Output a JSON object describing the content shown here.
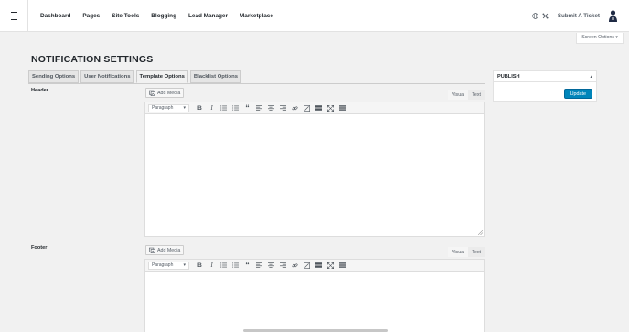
{
  "nav": {
    "items": [
      "Dashboard",
      "Pages",
      "Site Tools",
      "Blogging",
      "Lead Manager",
      "Marketplace"
    ],
    "submit_ticket": "Submit A Ticket"
  },
  "screen_options": "Screen Options ▾",
  "page_title": "NOTIFICATION SETTINGS",
  "tabs": [
    {
      "label": "Sending Options",
      "active": false
    },
    {
      "label": "User Notifications",
      "active": false
    },
    {
      "label": "Template Options",
      "active": true
    },
    {
      "label": "Blacklist Options",
      "active": false
    }
  ],
  "header_field": {
    "label": "Header",
    "add_media": "Add Media",
    "visual": "Visual",
    "text": "Text",
    "format": "Paragraph"
  },
  "footer_field": {
    "label": "Footer",
    "add_media": "Add Media",
    "visual": "Visual",
    "text": "Text",
    "format": "Paragraph"
  },
  "toolbar_icons": [
    "bold-icon",
    "italic-icon",
    "bulleted-list-icon",
    "numbered-list-icon",
    "blockquote-icon",
    "align-left-icon",
    "align-center-icon",
    "align-right-icon",
    "insert-link-icon",
    "remove-link-icon",
    "read-more-icon",
    "fullscreen-icon",
    "toolbar-toggle-icon"
  ],
  "publish": {
    "title": "PUBLISH",
    "update_label": "Update"
  },
  "colors": {
    "accent": "#0085ba",
    "background": "#f1f1f1"
  }
}
